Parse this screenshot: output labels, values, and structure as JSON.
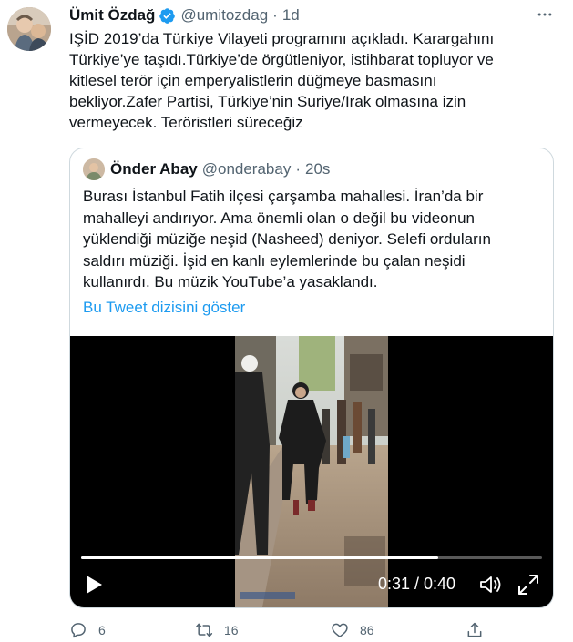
{
  "author": {
    "name": "Ümit Özdağ",
    "handle": "@umitozdag",
    "separator": "·",
    "time": "1d",
    "verified": true
  },
  "more_icon": "more-horizontal-icon",
  "tweet_text_lines": [
    "IŞİD 2019’da Türkiye Vilayeti programını açıkladı. Karargahını",
    "Türkiye’ye taşıdı.Türkiye’de örgütleniyor, istihbarat topluyor ve",
    "kitlesel terör için emperyalistlerin düğmeye basmasını",
    "bekliyor.Zafer Partisi, Türkiye’nin Suriye/Irak olmasına izin",
    "vermeyecek. Teröristleri süreceğiz"
  ],
  "quote": {
    "name": "Önder Abay",
    "handle": "@onderabay",
    "separator": "·",
    "time": "20s",
    "text_lines": [
      "Burası İstanbul Fatih ilçesi çarşamba mahallesi. İran’da bir",
      "mahalleyi andırıyor. Ama önemli olan o değil bu videonun",
      "yüklendiği müziğe neşid (Nasheed) deniyor. Selefi orduların",
      "saldırı müziği. İşid en kanlı eylemlerinde bu çalan neşidi",
      "kullanırdı. Bu müzik YouTube’a yasaklandı."
    ],
    "thread_link": "Bu Tweet dizisini göster"
  },
  "video": {
    "time_display": "0:31 / 0:40",
    "progress_fraction": 0.775,
    "play_icon": "play-icon",
    "volume_icon": "volume-icon",
    "fullscreen_icon": "expand-icon"
  },
  "actions": {
    "reply_count": "6",
    "retweet_count": "16",
    "like_count": "86"
  },
  "colors": {
    "accent": "#1d9bf0",
    "text": "#0f1419",
    "muted": "#536471",
    "border": "#cfd9de"
  }
}
